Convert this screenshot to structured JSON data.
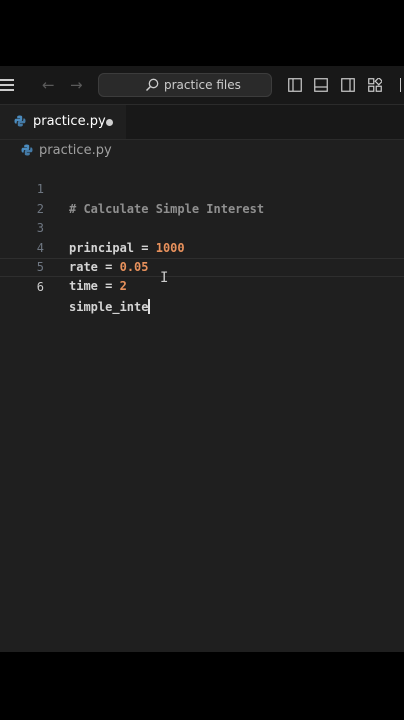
{
  "titlebar": {
    "search_text": "practice files"
  },
  "tabs": [
    {
      "label": "practice.py",
      "modified": true
    }
  ],
  "breadcrumb": {
    "file": "practice.py"
  },
  "editor": {
    "lines": [
      {
        "number": "1",
        "comment": "# Calculate Simple Interest"
      },
      {
        "number": "2"
      },
      {
        "number": "3",
        "name": "principal",
        "op": " = ",
        "value": "1000"
      },
      {
        "number": "4",
        "name": "rate",
        "op": " = ",
        "value": "0.05"
      },
      {
        "number": "5",
        "name": "time",
        "op": " = ",
        "value": "2"
      },
      {
        "number": "6",
        "name": "simple_inte",
        "current": true
      }
    ]
  },
  "colors": {
    "background": "#1f1f1f",
    "number_literal": "#e8915c",
    "comment": "#8f8f8f",
    "python_icon": "#4b8bbe"
  },
  "icons": {
    "menu": "hamburger-menu-icon",
    "back": "arrow-left-icon",
    "forward": "arrow-right-icon",
    "search": "search-icon",
    "layout": [
      "toggle-primary-sidebar-icon",
      "toggle-panel-icon",
      "toggle-secondary-sidebar-icon",
      "customize-layout-icon"
    ],
    "file": "python-file-icon"
  }
}
